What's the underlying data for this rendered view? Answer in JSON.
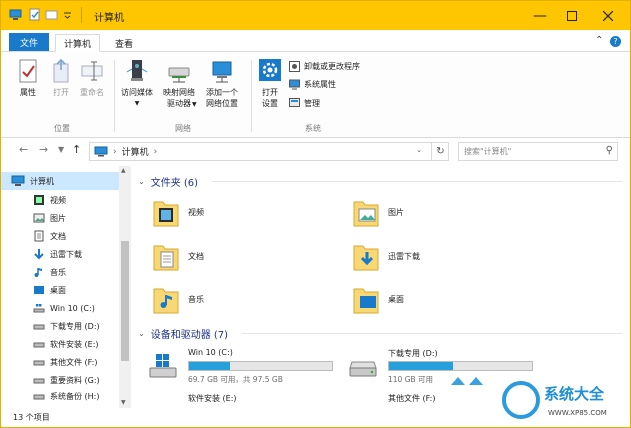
{
  "window": {
    "title": "计算机"
  },
  "ribbon_tabs": {
    "file": "文件",
    "computer": "计算机",
    "view": "查看"
  },
  "ribbon": {
    "location": {
      "properties": "属性",
      "open": "打开",
      "rename": "重命名",
      "group": "位置"
    },
    "network": {
      "access_media": "访问媒体",
      "map_drive_line1": "映射网络",
      "map_drive_line2": "驱动器",
      "add_location_line1": "添加一个",
      "add_location_line2": "网络位置",
      "group": "网络"
    },
    "system": {
      "open_settings_line1": "打开",
      "open_settings_line2": "设置",
      "uninstall": "卸载或更改程序",
      "sys_props": "系统属性",
      "manage": "管理",
      "group": "系统"
    }
  },
  "address": {
    "path": "计算机",
    "search_placeholder": "搜索\"计算机\""
  },
  "nav_pane": {
    "items": [
      {
        "label": "计算机"
      },
      {
        "label": "视频"
      },
      {
        "label": "图片"
      },
      {
        "label": "文档"
      },
      {
        "label": "迅雷下载"
      },
      {
        "label": "音乐"
      },
      {
        "label": "桌面"
      },
      {
        "label": "Win 10 (C:)"
      },
      {
        "label": "下载专用 (D:)"
      },
      {
        "label": "软件安装 (E:)"
      },
      {
        "label": "其他文件 (F:)"
      },
      {
        "label": "重要资料 (G:)"
      },
      {
        "label": "系统备份 (H:)"
      }
    ]
  },
  "folders_section": {
    "title": "文件夹 (6)",
    "items": [
      {
        "label": "视频"
      },
      {
        "label": "图片"
      },
      {
        "label": "文档"
      },
      {
        "label": "迅雷下载"
      },
      {
        "label": "音乐"
      },
      {
        "label": "桌面"
      }
    ]
  },
  "drives_section": {
    "title": "设备和驱动器 (7)",
    "items": [
      {
        "name": "Win 10 (C:)",
        "info": "69.7 GB 可用，共 97.5 GB",
        "used_fraction": 0.29
      },
      {
        "name": "下载专用 (D:)",
        "info": "110 GB 可用",
        "used_fraction": 0.45
      },
      {
        "name": "软件安装 (E:)"
      },
      {
        "name": "其他文件 (F:)"
      }
    ]
  },
  "status": {
    "count": "13 个项目"
  },
  "watermark": {
    "text": "系统大全",
    "url": "WWW.XP85.COM"
  },
  "colors": {
    "title_bar": "#fdc600",
    "accent": "#1979ca",
    "drive_fill": "#26a0da",
    "selection": "#cce8ff"
  }
}
